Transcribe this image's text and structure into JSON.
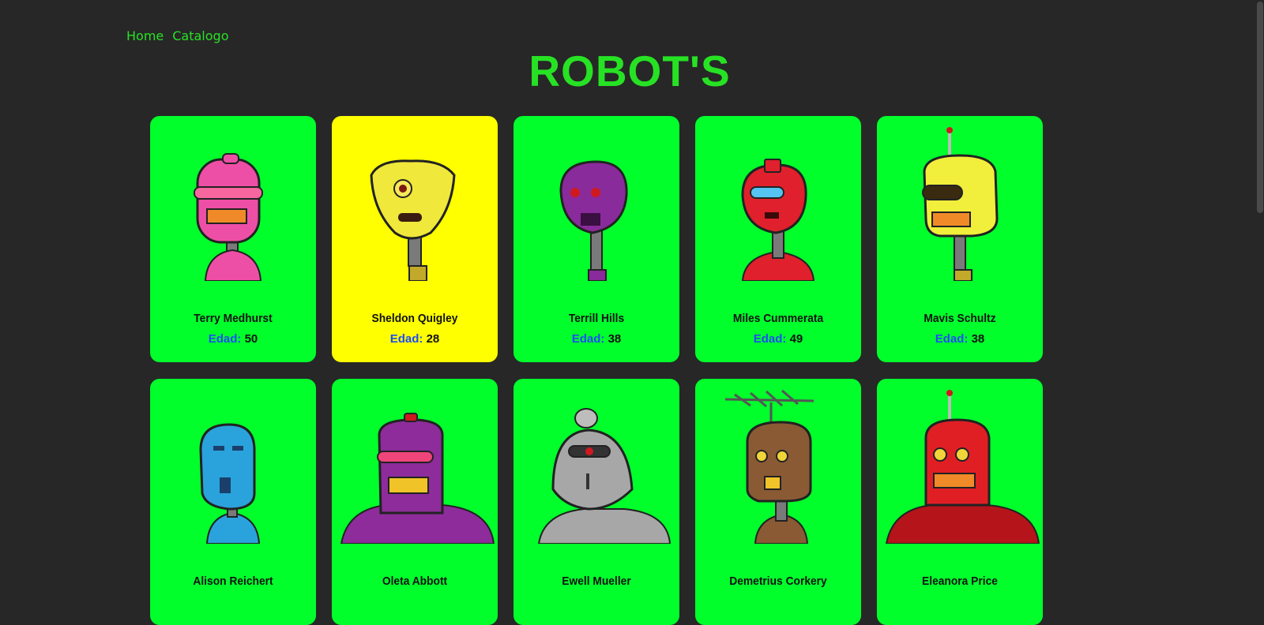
{
  "nav": {
    "home": "Home",
    "catalog": "Catalogo"
  },
  "title": "ROBOT'S",
  "age_label": "Edad:",
  "robots": [
    {
      "name": "Terry Medhurst",
      "age": "50",
      "head_color": "#ee4fa6",
      "card": "green"
    },
    {
      "name": "Sheldon Quigley",
      "age": "28",
      "head_color": "#f0e83a",
      "card": "yellow"
    },
    {
      "name": "Terrill Hills",
      "age": "38",
      "head_color": "#8a2b9b",
      "card": "green"
    },
    {
      "name": "Miles Cummerata",
      "age": "49",
      "head_color": "#e0202c",
      "card": "green"
    },
    {
      "name": "Mavis Schultz",
      "age": "38",
      "head_color": "#f2ee3c",
      "card": "green"
    },
    {
      "name": "Alison Reichert",
      "age": "",
      "head_color": "#2aa3dc",
      "card": "green"
    },
    {
      "name": "Oleta Abbott",
      "age": "",
      "head_color": "#8d2c9a",
      "card": "green"
    },
    {
      "name": "Ewell Mueller",
      "age": "",
      "head_color": "#a7a7a7",
      "card": "green"
    },
    {
      "name": "Demetrius Corkery",
      "age": "",
      "head_color": "#8a5a34",
      "card": "green"
    },
    {
      "name": "Eleanora Price",
      "age": "",
      "head_color": "#e01f25",
      "card": "green"
    }
  ]
}
